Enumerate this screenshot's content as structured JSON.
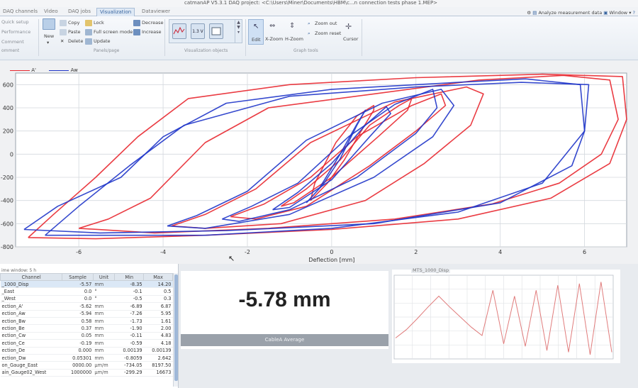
{
  "window": {
    "title": "catmanAP V5.3.1 DAQ project: <C:\\Users\\Miner\\Documents\\HBM\\c...n connection tests phase 1.MEP>"
  },
  "tabs": [
    {
      "label": "DAQ channels",
      "active": false
    },
    {
      "label": "Video",
      "active": false
    },
    {
      "label": "DAQ jobs",
      "active": false
    },
    {
      "label": "Visualization",
      "active": true
    },
    {
      "label": "Dataviewer",
      "active": false
    }
  ],
  "right_tools": {
    "analyze": "Analyze measurement data",
    "window": "Window"
  },
  "ribbon": {
    "quick_setup": "Quick setup",
    "performance": "Performance",
    "comment": "Comment",
    "comment_group": "omment",
    "new": "New",
    "copy": "Copy",
    "paste": "Paste",
    "delete": "Delete",
    "lock": "Lock",
    "full_screen": "Full screen mode",
    "update": "Update",
    "decrease": "Decrease",
    "increase": "Increase",
    "panels_label": "Panels/page",
    "viz_objects_label": "Visualization objects",
    "viz_numeric": "1.3 V",
    "edit": "Edit",
    "xzoom": "X-Zoom",
    "hzoom": "H-Zoom",
    "zoom_out": "Zoom out",
    "zoom_reset": "Zoom reset",
    "cursor": "Cursor",
    "graph_tools_label": "Graph tools"
  },
  "colors": {
    "series_a": "#e8272f",
    "series_aw": "#1f35c9",
    "accent": "#3a66a0"
  },
  "chart_data": {
    "type": "line",
    "xlabel": "Deflection  [mm]",
    "ylabel": "",
    "xlim": [
      -7.5,
      7.0
    ],
    "ylim": [
      -800,
      700
    ],
    "xticks": [
      -6,
      -4,
      -2,
      0,
      2,
      4,
      6
    ],
    "yticks": [
      600,
      400,
      200,
      0,
      -200,
      -400,
      -600,
      -800
    ],
    "grid": true,
    "legend": "top-left",
    "series": [
      {
        "name": "A'",
        "color": "#e8272f",
        "loops": [
          {
            "x": [
              -0.5,
              -0.1,
              0.3,
              0.7,
              1.0,
              1.0,
              0.6,
              0.1,
              -0.4,
              -0.5
            ],
            "y": [
              -400,
              -250,
              -50,
              200,
              380,
              420,
              330,
              100,
              -250,
              -400
            ]
          },
          {
            "x": [
              -1.2,
              -0.6,
              0.2,
              0.9,
              1.6,
              1.9,
              1.8,
              1.1,
              0.0,
              -0.9,
              -1.2
            ],
            "y": [
              -450,
              -300,
              -50,
              250,
              420,
              480,
              380,
              150,
              -200,
              -420,
              -450
            ]
          },
          {
            "x": [
              -2.4,
              -1.6,
              -0.5,
              0.6,
              1.9,
              2.6,
              2.7,
              2.0,
              0.9,
              -0.6,
              -1.8,
              -2.4
            ],
            "y": [
              -540,
              -430,
              -200,
              150,
              420,
              520,
              420,
              200,
              -100,
              -450,
              -560,
              -540
            ]
          },
          {
            "x": [
              -3.8,
              -3.0,
              -1.8,
              -0.5,
              1.5,
              3.2,
              3.6,
              3.3,
              2.2,
              0.8,
              -1.2,
              -3.0,
              -3.8
            ],
            "y": [
              -620,
              -520,
              -300,
              100,
              450,
              580,
              520,
              250,
              -80,
              -400,
              -600,
              -640,
              -620
            ]
          },
          {
            "x": [
              -6.0,
              -5.3,
              -4.3,
              -3.0,
              -1.5,
              1.0,
              3.5,
              5.5,
              6.6,
              6.8,
              6.4,
              5.4,
              3.8,
              1.5,
              -1.5,
              -4.2,
              -6.0
            ],
            "y": [
              -640,
              -560,
              -380,
              100,
              400,
              520,
              640,
              680,
              640,
              300,
              0,
              -250,
              -430,
              -560,
              -640,
              -680,
              -640
            ]
          },
          {
            "x": [
              -7.2,
              -6.6,
              -5.6,
              -4.6,
              -3.4,
              -1.0,
              2.0,
              5.0,
              6.9,
              7.0,
              6.6,
              5.2,
              3.0,
              0.0,
              -3.0,
              -5.6,
              -7.2
            ],
            "y": [
              -720,
              -520,
              -200,
              150,
              480,
              600,
              660,
              690,
              670,
              300,
              -80,
              -380,
              -560,
              -650,
              -700,
              -730,
              -720
            ]
          }
        ]
      },
      {
        "name": "Aw",
        "color": "#1f35c9",
        "loops": [
          {
            "x": [
              -0.6,
              -0.2,
              0.2,
              0.6,
              0.8,
              0.6,
              0.2,
              -0.3,
              -0.6
            ],
            "y": [
              -420,
              -260,
              -40,
              250,
              380,
              260,
              0,
              -300,
              -420
            ]
          },
          {
            "x": [
              -1.4,
              -0.8,
              0.0,
              0.8,
              1.3,
              1.4,
              0.9,
              0.0,
              -1.0,
              -1.4
            ],
            "y": [
              -480,
              -330,
              -80,
              250,
              410,
              350,
              150,
              -220,
              -460,
              -480
            ]
          },
          {
            "x": [
              -2.6,
              -1.9,
              -0.8,
              0.4,
              1.5,
              2.4,
              2.5,
              2.0,
              0.6,
              -1.0,
              -2.2,
              -2.6
            ],
            "y": [
              -560,
              -450,
              -250,
              150,
              430,
              560,
              400,
              180,
              -200,
              -480,
              -580,
              -560
            ]
          },
          {
            "x": [
              -3.9,
              -3.2,
              -2.0,
              -0.6,
              1.2,
              2.6,
              2.9,
              2.4,
              1.0,
              -1.0,
              -3.0,
              -3.9
            ],
            "y": [
              -620,
              -530,
              -320,
              120,
              440,
              560,
              420,
              150,
              -200,
              -520,
              -640,
              -620
            ]
          },
          {
            "x": [
              -7.3,
              -6.5,
              -5.0,
              -4.0,
              -2.5,
              0.0,
              3.0,
              4.6,
              5.9,
              6.0,
              5.7,
              4.0,
              1.0,
              -2.5,
              -5.5,
              -7.3
            ],
            "y": [
              -650,
              -450,
              -200,
              150,
              440,
              560,
              620,
              650,
              600,
              200,
              -100,
              -420,
              -600,
              -660,
              -680,
              -650
            ]
          },
          {
            "x": [
              -6.8,
              -6.0,
              -4.8,
              -3.5,
              -1.0,
              2.0,
              4.5,
              6.1,
              6.0,
              5.0,
              3.0,
              0.0,
              -3.0,
              -6.8
            ],
            "y": [
              -700,
              -450,
              -100,
              250,
              500,
              580,
              620,
              600,
              200,
              -250,
              -500,
              -640,
              -700,
              -700
            ]
          }
        ]
      }
    ]
  },
  "channel_table": {
    "caption": "ime window: 5 h",
    "headers": [
      "Channel",
      "Sample",
      "Unit",
      "Min",
      "Max"
    ],
    "rows": [
      [
        "_1000_Disp",
        "-5.57",
        "mm",
        "-8.35",
        "14.20"
      ],
      [
        "_East",
        "0.0",
        "°",
        "-0.1",
        "0.5"
      ],
      [
        "_West",
        "0.0",
        "°",
        "-0.5",
        "0.3"
      ],
      [
        "ection_A'",
        "-5.62",
        "mm",
        "-6.89",
        "6.87"
      ],
      [
        "ection_Aw",
        "-5.94",
        "mm",
        "-7.26",
        "5.95"
      ],
      [
        "ection_Bw",
        "0.58",
        "mm",
        "-1.73",
        "1.61"
      ],
      [
        "ection_Be",
        "0.37",
        "mm",
        "-1.90",
        "2.00"
      ],
      [
        "ection_Cw",
        "0.05",
        "mm",
        "-0.11",
        "4.83"
      ],
      [
        "ection_Ce",
        "-0.19",
        "mm",
        "-0.59",
        "4.18"
      ],
      [
        "ection_De",
        "0.000",
        "mm",
        "0.00139",
        "0.00139"
      ],
      [
        "ection_Dw",
        "0.05301",
        "mm",
        "-0.8059",
        "2.642"
      ],
      [
        "on_Gauge_East",
        "0000.00",
        "µm/m",
        "-734.05",
        "8197.50"
      ],
      [
        "ain_Gauge02_West",
        "1000000",
        "µm/m",
        "-299.29",
        "16673"
      ]
    ]
  },
  "digital_display": {
    "value": "-5.78 mm",
    "caption": "CableA Average"
  },
  "mini_chart": {
    "title": "MTS_1000_Disp",
    "type": "line",
    "color": "#e07b7b",
    "values": [
      0.25,
      0.35,
      0.48,
      0.62,
      0.75,
      0.62,
      0.5,
      0.38,
      0.28,
      0.82,
      0.18,
      0.75,
      0.15,
      0.82,
      0.1,
      0.88,
      0.08,
      0.9,
      0.05,
      0.92,
      0.08
    ]
  }
}
